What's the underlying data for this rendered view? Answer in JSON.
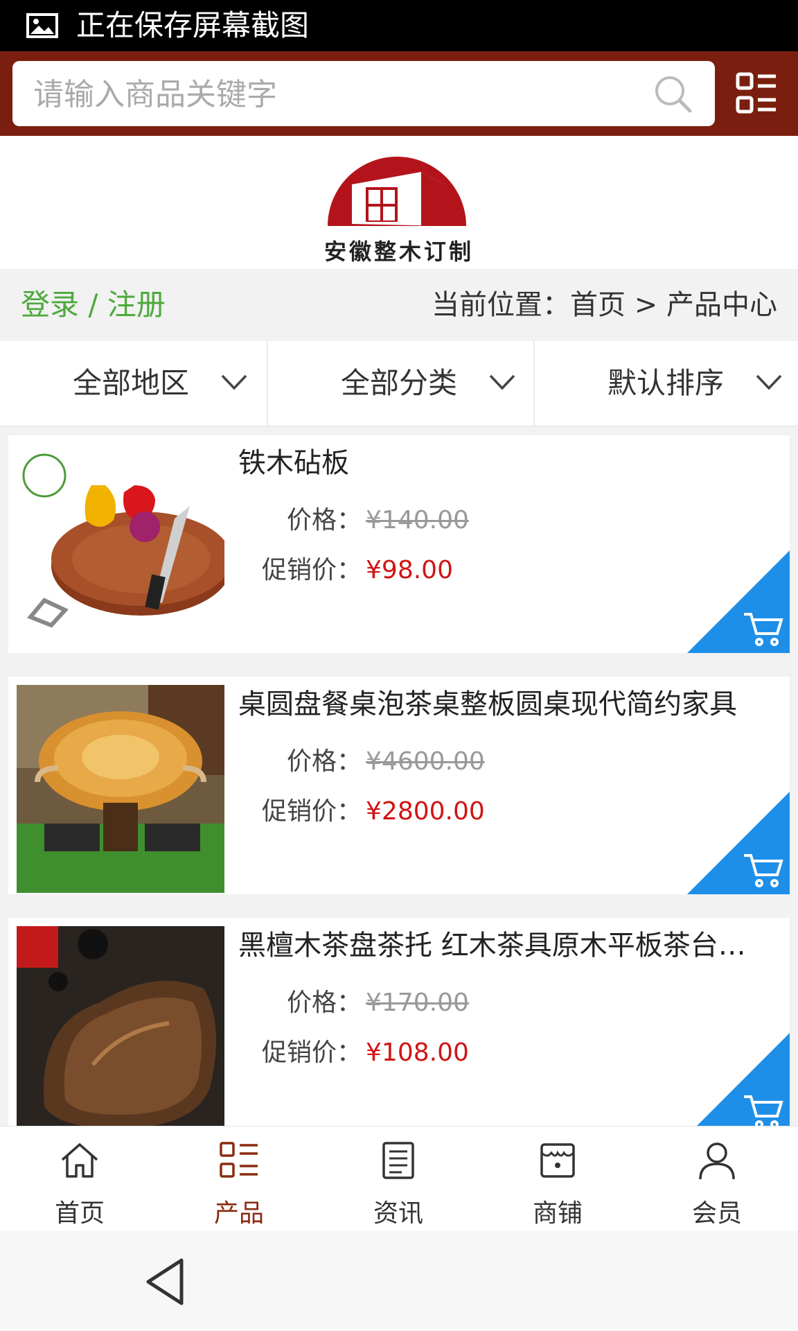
{
  "status_bar": {
    "text": "正在保存屏幕截图"
  },
  "search": {
    "placeholder": "请输入商品关键字"
  },
  "brand": {
    "name": "安徽整木订制",
    "color": "#b3141c"
  },
  "theme": {
    "header_color": "#7a1f0f",
    "accent_green": "#4caa3b",
    "price_red": "#d01414",
    "cart_blue": "#1e8fe8"
  },
  "breadcrumb": {
    "login_label": "登录 / 注册",
    "location_label": "当前位置：首页 > 产品中心"
  },
  "filters": [
    {
      "label": "全部地区",
      "icon": "chevron-down-icon"
    },
    {
      "label": "全部分类",
      "icon": "chevron-down-icon"
    },
    {
      "label": "默认排序",
      "icon": "chevron-down-icon"
    }
  ],
  "products": [
    {
      "name": "铁木砧板",
      "price_label": "价格：",
      "price": "¥140.00",
      "promo_label": "促销价：",
      "promo_price": "¥98.00"
    },
    {
      "name": "桌圆盘餐桌泡茶桌整板圆桌现代简约家具",
      "price_label": "价格：",
      "price": "¥4600.00",
      "promo_label": "促销价：",
      "promo_price": "¥2800.00"
    },
    {
      "name": "黑檀木茶盘茶托 红木茶具原木平板茶台…",
      "price_label": "价格：",
      "price": "¥170.00",
      "promo_label": "促销价：",
      "promo_price": "¥108.00"
    }
  ],
  "tabbar": [
    {
      "label": "首页",
      "icon": "home-icon",
      "active": false
    },
    {
      "label": "产品",
      "icon": "grid-list-icon",
      "active": true
    },
    {
      "label": "资讯",
      "icon": "document-icon",
      "active": false
    },
    {
      "label": "商铺",
      "icon": "store-icon",
      "active": false
    },
    {
      "label": "会员",
      "icon": "user-icon",
      "active": false
    }
  ]
}
